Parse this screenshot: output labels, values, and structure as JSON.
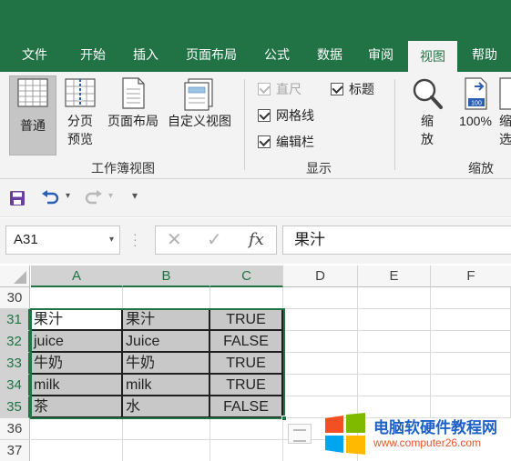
{
  "ribbon_tabs": [
    "文件",
    "开始",
    "插入",
    "页面布局",
    "公式",
    "数据",
    "审阅",
    "视图",
    "帮助"
  ],
  "active_tab": "视图",
  "workbook_views": {
    "buttons": [
      "普通",
      "分页预览",
      "页面布局",
      "自定义视图"
    ],
    "split_label": [
      "分页",
      "预览"
    ],
    "group_label": "工作簿视图"
  },
  "show": {
    "checkboxes": [
      "直尺",
      "标题",
      "网格线",
      "编辑栏"
    ],
    "group_label": "显示"
  },
  "zoom": {
    "zoom_label": [
      "缩",
      "放"
    ],
    "zoom100_label": "100%",
    "zoom100_icon_text": "100",
    "partial_label": [
      "缩",
      "选"
    ],
    "group_label": "缩放"
  },
  "name_box": "A31",
  "formula_value": "果汁",
  "columns": [
    "A",
    "B",
    "C",
    "D",
    "E",
    "F"
  ],
  "rows": [
    "30",
    "31",
    "32",
    "33",
    "34",
    "35",
    "36",
    "37"
  ],
  "cells": [
    [
      "",
      "",
      ""
    ],
    [
      "果汁",
      "果汁",
      "TRUE"
    ],
    [
      "juice",
      "Juice",
      "FALSE"
    ],
    [
      "牛奶",
      "牛奶",
      "TRUE"
    ],
    [
      "milk",
      "milk",
      "TRUE"
    ],
    [
      "茶",
      "水",
      "FALSE"
    ],
    [
      "",
      "",
      ""
    ],
    [
      "",
      "",
      ""
    ]
  ],
  "watermark": {
    "title": "电脑软硬件教程网",
    "url": "www.computer26.com"
  },
  "colors": {
    "excel_green": "#217346",
    "selection_fill": "#c8c8c8"
  }
}
